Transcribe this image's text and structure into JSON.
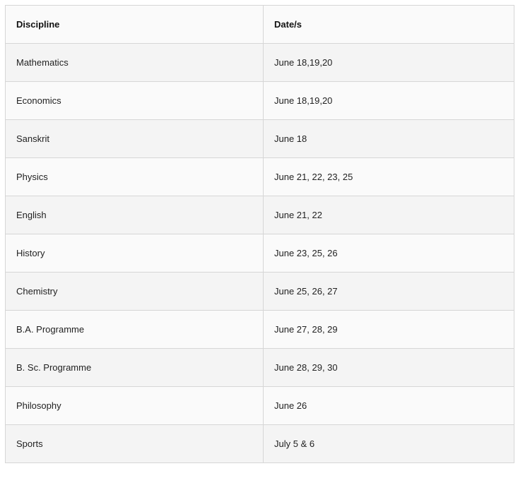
{
  "table": {
    "headers": [
      "Discipline",
      "Date/s"
    ],
    "rows": [
      [
        "Mathematics",
        "June 18,19,20"
      ],
      [
        "Economics",
        "June 18,19,20"
      ],
      [
        "Sanskrit",
        "June 18"
      ],
      [
        "Physics",
        "June 21, 22, 23, 25"
      ],
      [
        "English",
        "June 21, 22"
      ],
      [
        "History",
        "June 23, 25, 26"
      ],
      [
        "Chemistry",
        "June 25, 26, 27"
      ],
      [
        "B.A. Programme",
        "June 27, 28, 29"
      ],
      [
        "B. Sc. Programme",
        "June 28, 29, 30"
      ],
      [
        "Philosophy",
        "June 26"
      ],
      [
        "Sports",
        "July 5 & 6"
      ]
    ]
  }
}
